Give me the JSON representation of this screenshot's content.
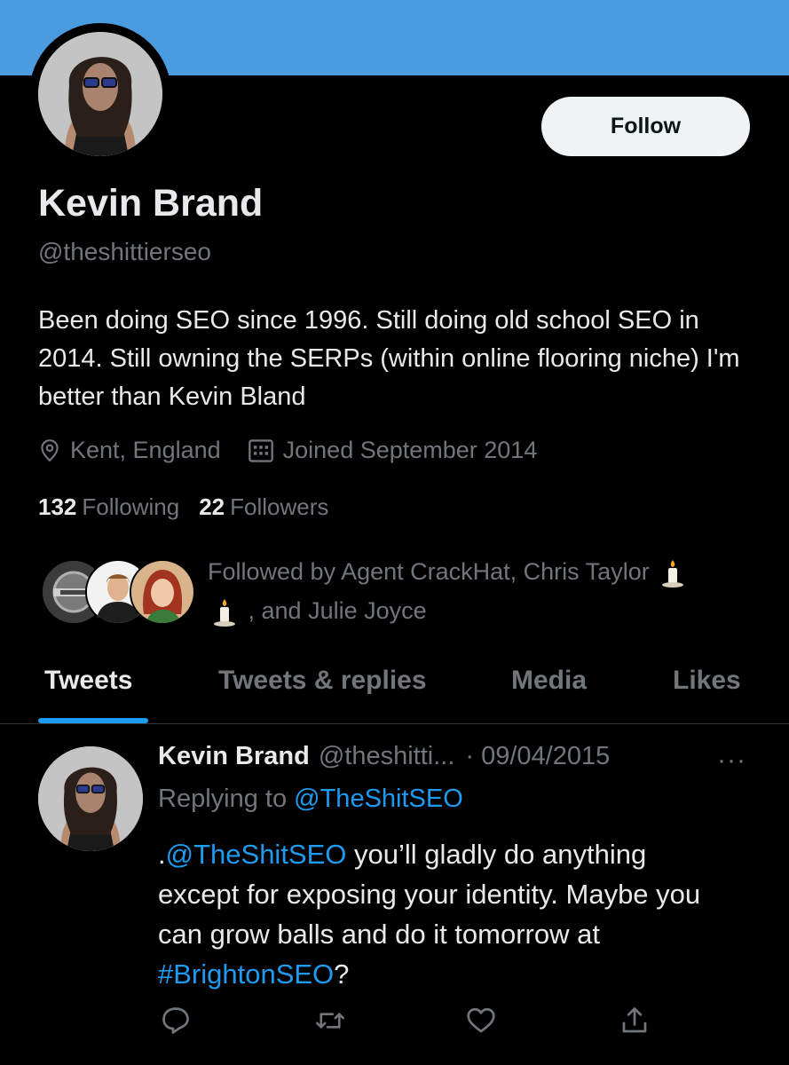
{
  "colors": {
    "banner": "#4a9be0",
    "accent": "#1d9bf0",
    "background": "#000000",
    "muted": "#71767b"
  },
  "profile": {
    "name": "Kevin Brand",
    "handle": "@theshittierseo",
    "follow_label": "Follow",
    "bio": "Been doing SEO since 1996. Still doing old school SEO in 2014. Still owning the SERPs (within online flooring niche) I'm better than Kevin Bland",
    "location": "Kent, England",
    "joined": "Joined September 2014",
    "following_count": "132",
    "following_label": "Following",
    "followers_count": "22",
    "followers_label": "Followers",
    "followed_by_prefix": "Followed by Agent CrackHat, Chris Taylor",
    "followed_by_suffix": ", and Julie Joyce",
    "icons": {
      "location": "location-pin-icon",
      "joined": "calendar-icon",
      "candle": "candle-emoji"
    }
  },
  "tabs": [
    {
      "label": "Tweets",
      "active": true
    },
    {
      "label": "Tweets & replies",
      "active": false
    },
    {
      "label": "Media",
      "active": false
    },
    {
      "label": "Likes",
      "active": false
    }
  ],
  "tweet": {
    "name": "Kevin Brand",
    "handle": "@theshitti...",
    "date": "· 09/04/2015",
    "more": "···",
    "replying_prefix": "Replying to",
    "replying_to": "@TheShitSEO",
    "text_prefix": ".",
    "mention": "@TheShitSEO",
    "text_body": " you’ll gladly do anything except for exposing your identity. Maybe you can grow balls and do it tomorrow at ",
    "hashtag": "#BrightonSEO",
    "text_suffix": "?",
    "actions": [
      "reply-icon",
      "retweet-icon",
      "like-icon",
      "share-icon"
    ]
  }
}
